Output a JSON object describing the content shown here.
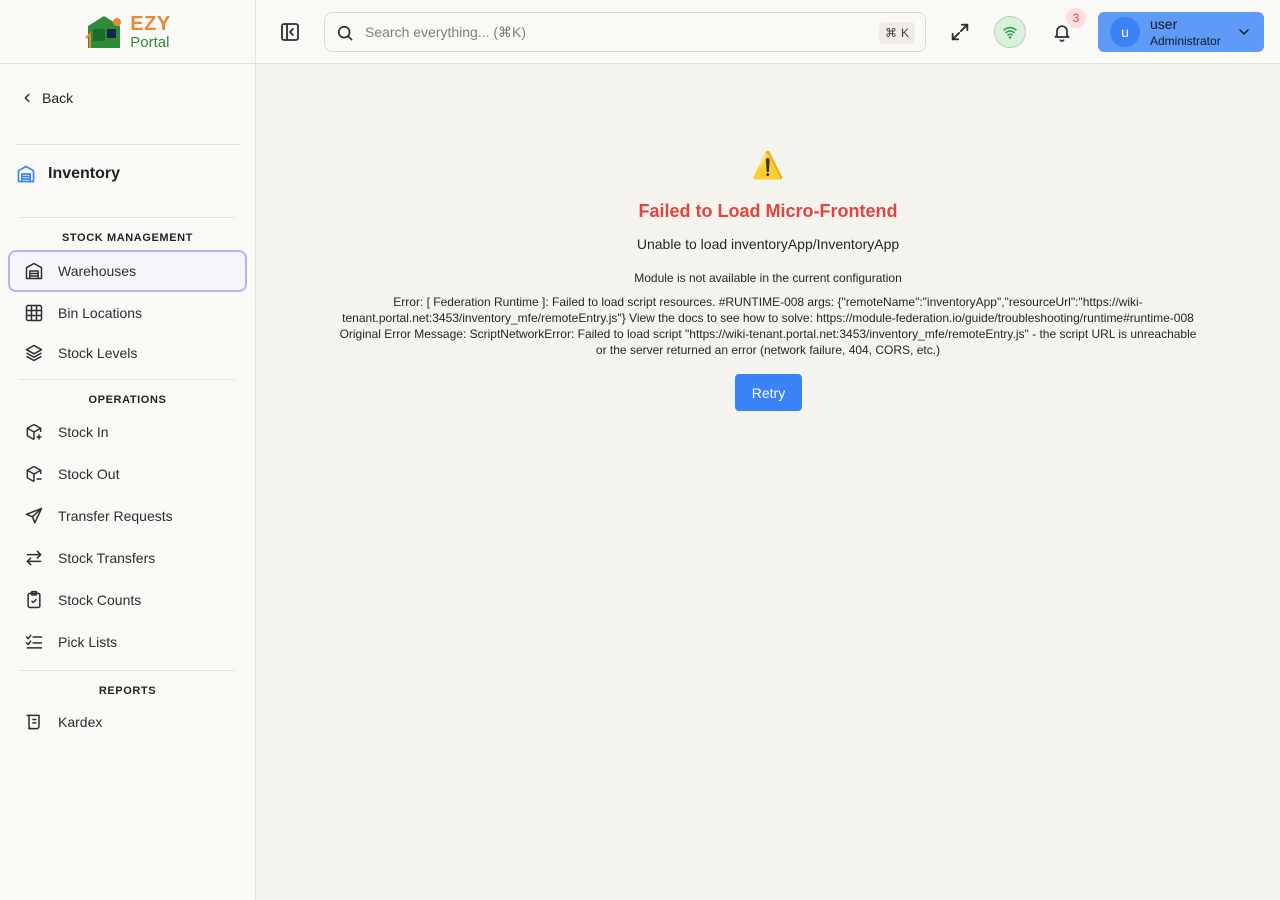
{
  "brand": {
    "name_top": "EZY",
    "name_bottom": "Portal"
  },
  "sidebar": {
    "back_label": "Back",
    "module_title": "Inventory",
    "sections": [
      {
        "title": "STOCK MANAGEMENT"
      },
      {
        "title": "OPERATIONS"
      },
      {
        "title": "REPORTS"
      }
    ],
    "items": [
      {
        "label": "Warehouses",
        "icon": "warehouse-icon",
        "active": true
      },
      {
        "label": "Bin Locations",
        "icon": "grid-icon"
      },
      {
        "label": "Stock Levels",
        "icon": "layers-icon"
      },
      {
        "label": "Stock In",
        "icon": "package-plus-icon"
      },
      {
        "label": "Stock Out",
        "icon": "package-minus-icon"
      },
      {
        "label": "Transfer Requests",
        "icon": "send-icon"
      },
      {
        "label": "Stock Transfers",
        "icon": "arrows-left-right-icon"
      },
      {
        "label": "Stock Counts",
        "icon": "clipboard-check-icon"
      },
      {
        "label": "Pick Lists",
        "icon": "list-checks-icon"
      },
      {
        "label": "Kardex",
        "icon": "scroll-icon"
      }
    ]
  },
  "header": {
    "search_placeholder": "Search everything... (⌘K)",
    "shortcut_symbol": "⌘",
    "shortcut_key": "K",
    "notification_count": "3",
    "user": {
      "initial": "u",
      "name": "user",
      "role": "Administrator"
    }
  },
  "error": {
    "icon": "⚠️",
    "title": "Failed to Load Micro-Frontend",
    "subtitle": "Unable to load inventoryApp/InventoryApp",
    "message": "Module is not available in the current configuration",
    "detail": "Error: [ Federation Runtime ]: Failed to load script resources. #RUNTIME-008 args: {\"remoteName\":\"inventoryApp\",\"resourceUrl\":\"https://wiki-tenant.portal.net:3453/inventory_mfe/remoteEntry.js\"} View the docs to see how to solve: https://module-federation.io/guide/troubleshooting/runtime#runtime-008 Original Error Message: ScriptNetworkError: Failed to load script \"https://wiki-tenant.portal.net:3453/inventory_mfe/remoteEntry.js\" - the script URL is unreachable or the server returned an error (network failure, 404, CORS, etc.)",
    "retry_label": "Retry"
  },
  "colors": {
    "accent": "#3b82f6",
    "error": "#e0453f",
    "sidebar_bg": "#faf9f5",
    "main_bg": "#f5f3ee"
  }
}
